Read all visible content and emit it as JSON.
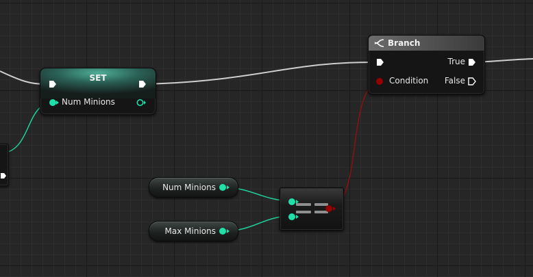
{
  "set_node": {
    "title": "SET",
    "pin_label": "Num Minions"
  },
  "branch_node": {
    "title": "Branch",
    "condition_label": "Condition",
    "true_label": "True",
    "false_label": "False"
  },
  "getters": {
    "num_minions": "Num Minions",
    "max_minions": "Max Minions"
  },
  "colors": {
    "exec_wire": "#d6d6d6",
    "integer_pin": "#1fe0a8",
    "boolean_pin": "#950000",
    "boolean_wire": "#7a0f0f"
  }
}
